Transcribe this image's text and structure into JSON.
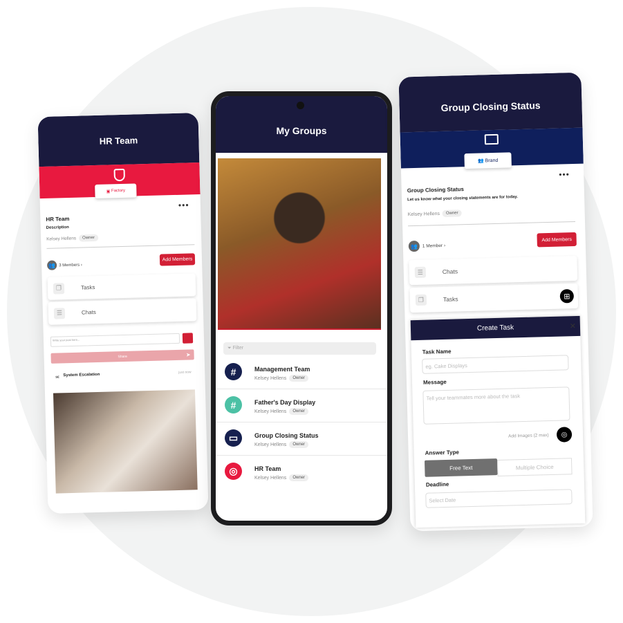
{
  "left_phone": {
    "title": "HR Team",
    "tag": "Factory",
    "group_name": "HR Team",
    "description_label": "Description",
    "owner_name": "Kelsey Hellens",
    "owner_badge": "Owner",
    "members": "3 Members",
    "add_members": "Add Members",
    "cards": [
      "Tasks",
      "Chats"
    ],
    "post_placeholder": "Write your post here...",
    "share": "Share",
    "feed_author": "System Escalation",
    "feed_initials": "SE",
    "feed_time": "just now",
    "brand_color": "#e8193f",
    "header_color": "#1a1a3e"
  },
  "middle_phone": {
    "title": "My Groups",
    "filter_placeholder": "Filter",
    "groups": [
      {
        "name": "Management Team",
        "owner": "Kelsey Hellens",
        "badge": "Owner",
        "icon": "hash-icon",
        "color": "#16204f"
      },
      {
        "name": "Father's Day Display",
        "owner": "Kelsey Hellens",
        "badge": "Owner",
        "icon": "hash-icon",
        "color": "#4cc1a5"
      },
      {
        "name": "Group Closing Status",
        "owner": "Kelsey Hellens",
        "badge": "Owner",
        "icon": "folder-icon",
        "color": "#16204f"
      },
      {
        "name": "HR Team",
        "owner": "Kelsey Hellens",
        "badge": "Owner",
        "icon": "shield-icon",
        "color": "#e8193f"
      }
    ]
  },
  "right_phone": {
    "title": "Group Closing Status",
    "tag": "Brand",
    "group_name": "Group Closing Status",
    "description": "Let us know what your closing statements are for today.",
    "owner_name": "Kelsey Hellens",
    "owner_badge": "Owner",
    "members": "1 Member",
    "add_members": "Add Members",
    "cards": [
      "Chats",
      "Tasks"
    ],
    "create_task": {
      "title": "Create Task",
      "task_name_label": "Task Name",
      "task_name_placeholder": "eg. Cake Displays",
      "message_label": "Message",
      "message_placeholder": "Tell your teammates more about the task",
      "add_images": "Add Images (2 max)",
      "answer_type_label": "Answer Type",
      "answer_options": [
        "Free Text",
        "Multiple Choice"
      ],
      "selected_answer": "Free Text",
      "deadline_label": "Deadline",
      "deadline_placeholder": "Select Date"
    },
    "band_color": "#0f1f5c"
  }
}
